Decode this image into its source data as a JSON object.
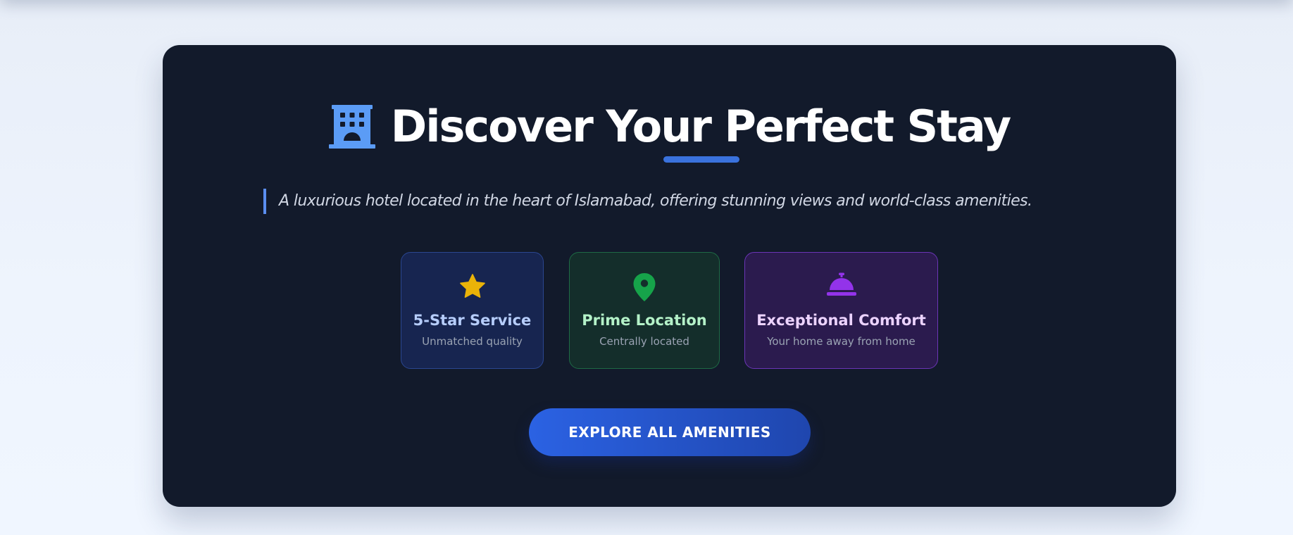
{
  "hero": {
    "title": "Discover Your Perfect Stay",
    "title_icon": "hotel-icon",
    "tagline": "A luxurious hotel located in the heart of Islamabad, offering stunning views and world-class amenities."
  },
  "features": [
    {
      "icon": "star-icon",
      "title": "5-Star Service",
      "description": "Unmatched quality",
      "accent": "#eab308"
    },
    {
      "icon": "map-pin-icon",
      "title": "Prime Location",
      "description": "Centrally located",
      "accent": "#16a34a"
    },
    {
      "icon": "concierge-bell-icon",
      "title": "Exceptional Comfort",
      "description": "Your home away from home",
      "accent": "#9333ea"
    }
  ],
  "cta": {
    "label": "EXPLORE ALL AMENITIES"
  },
  "colors": {
    "page_background": "#eef4fd",
    "card_background": "#121a2b",
    "accent_blue": "#5b9cf6",
    "button_gradient_start": "#2b62e3",
    "button_gradient_end": "#1f46ae"
  }
}
